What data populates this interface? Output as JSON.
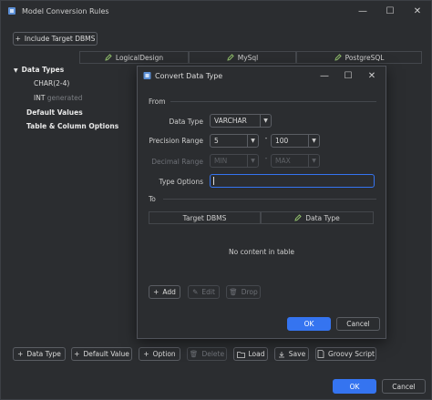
{
  "window": {
    "title": "Model Conversion Rules",
    "controls": {
      "minimize": "—",
      "maximize": "☐",
      "close": "✕"
    }
  },
  "toolbar": {
    "include_target_label": "Include Target DBMS"
  },
  "columns": [
    {
      "label": "LogicalDesign",
      "icon": "pencil-icon"
    },
    {
      "label": "MySql",
      "icon": "pencil-icon"
    },
    {
      "label": "PostgreSQL",
      "icon": "pencil-icon"
    }
  ],
  "tree": {
    "data_types": "Data Types",
    "char_item": "CHAR(2-4)",
    "int_item": "INT",
    "int_suffix": "generated",
    "default_values": "Default Values",
    "table_column_options": "Table & Column Options"
  },
  "bottom_bar": {
    "data_type": "Data Type",
    "default_value": "Default Value",
    "option": "Option",
    "delete": "Delete",
    "load": "Load",
    "save": "Save",
    "groovy_script": "Groovy Script",
    "ok": "OK",
    "cancel": "Cancel"
  },
  "dialog": {
    "title": "Convert Data Type",
    "controls": {
      "minimize": "—",
      "maximize": "☐",
      "close": "✕"
    },
    "from_label": "From",
    "data_type_label": "Data Type",
    "data_type_value": "VARCHAR",
    "precision_label": "Precision Range",
    "precision_min": "5",
    "precision_dash": "-",
    "precision_max": "100",
    "decimal_label": "Decimal Range",
    "decimal_min": "MIN",
    "decimal_dash": "-",
    "decimal_max": "MAX",
    "type_options_label": "Type Options",
    "type_options_value": "",
    "to_label": "To",
    "table_headers": [
      "Target DBMS",
      "Data Type"
    ],
    "empty_text": "No content in table",
    "add": "Add",
    "edit": "Edit",
    "drop": "Drop",
    "ok": "OK",
    "cancel": "Cancel"
  },
  "colors": {
    "accent": "#3574f0",
    "background": "#2b2d30",
    "border": "#5a5d63"
  }
}
